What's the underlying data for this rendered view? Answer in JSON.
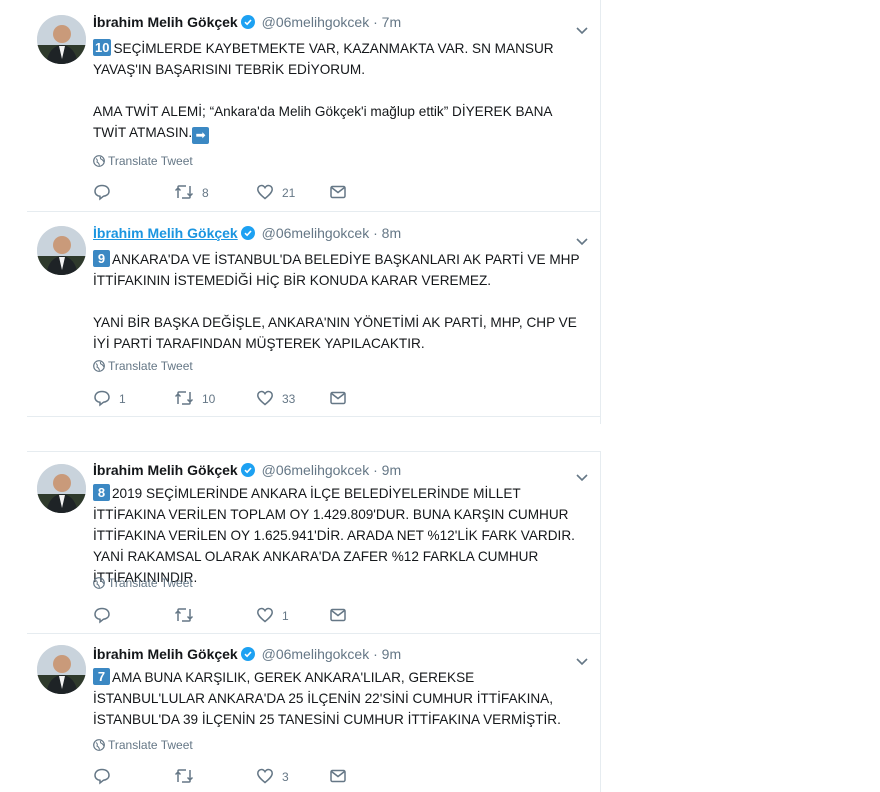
{
  "author": {
    "name": "İbrahim Melih Gökçek",
    "handle": "@06melihgokcek"
  },
  "translate_label": "Translate Tweet",
  "tweets": [
    {
      "time": "7m",
      "badge": "10",
      "lines": [
        "SEÇİMLERDE KAYBETMEKTE VAR, KAZANMAKTA VAR. SN MANSUR YAVAŞ'IN BAŞARISINI TEBRİK EDİYORUM.",
        "AMA TWİT ALEMİ; “Ankara'da Melih Gökçek'i mağlup ettik” DİYEREK BANA TWİT ATMASIN."
      ],
      "reply_count": "",
      "retweet_count": "8",
      "like_count": "21"
    },
    {
      "time": "8m",
      "badge": "9",
      "lines": [
        "ANKARA'DA VE İSTANBUL'DA BELEDİYE BAŞKANLARI AK PARTİ VE MHP İTTİFAKININ İSTEMEDİĞİ HİÇ BİR KONUDA KARAR VEREMEZ.",
        "YANİ BİR BAŞKA DEĞİŞLE, ANKARA'NIN YÖNETİMİ AK PARTİ, MHP, CHP VE İYİ PARTİ TARAFINDAN MÜŞTEREK YAPILACAKTIR."
      ],
      "reply_count": "1",
      "retweet_count": "10",
      "like_count": "33"
    },
    {
      "time": "9m",
      "badge": "8",
      "lines": [
        "2019 SEÇİMLERİNDE ANKARA İLÇE BELEDİYELERİNDE MİLLET İTTİFAKINA VERİLEN TOPLAM OY 1.429.809'DUR. BUNA KARŞIN CUMHUR İTTİFAKINA VERİLEN OY 1.625.941'DİR. ARADA NET %12'LİK FARK VARDIR. YANİ RAKAMSAL OLARAK ANKARA'DA ZAFER %12 FARKLA CUMHUR İTTİFAKININDIR."
      ],
      "reply_count": "",
      "retweet_count": "",
      "like_count": "1"
    },
    {
      "time": "9m",
      "badge": "7",
      "lines": [
        "AMA BUNA KARŞILIK, GEREK ANKARA'LILAR, GEREKSE İSTANBUL'LULAR ANKARA'DA 25 İLÇENİN 22'SİNİ CUMHUR İTTİFAKINA, İSTANBUL'DA 39 İLÇENİN 25 TANESİNİ CUMHUR İTTİFAKINA VERMİŞTİR."
      ],
      "reply_count": "",
      "retweet_count": "",
      "like_count": "3"
    }
  ]
}
